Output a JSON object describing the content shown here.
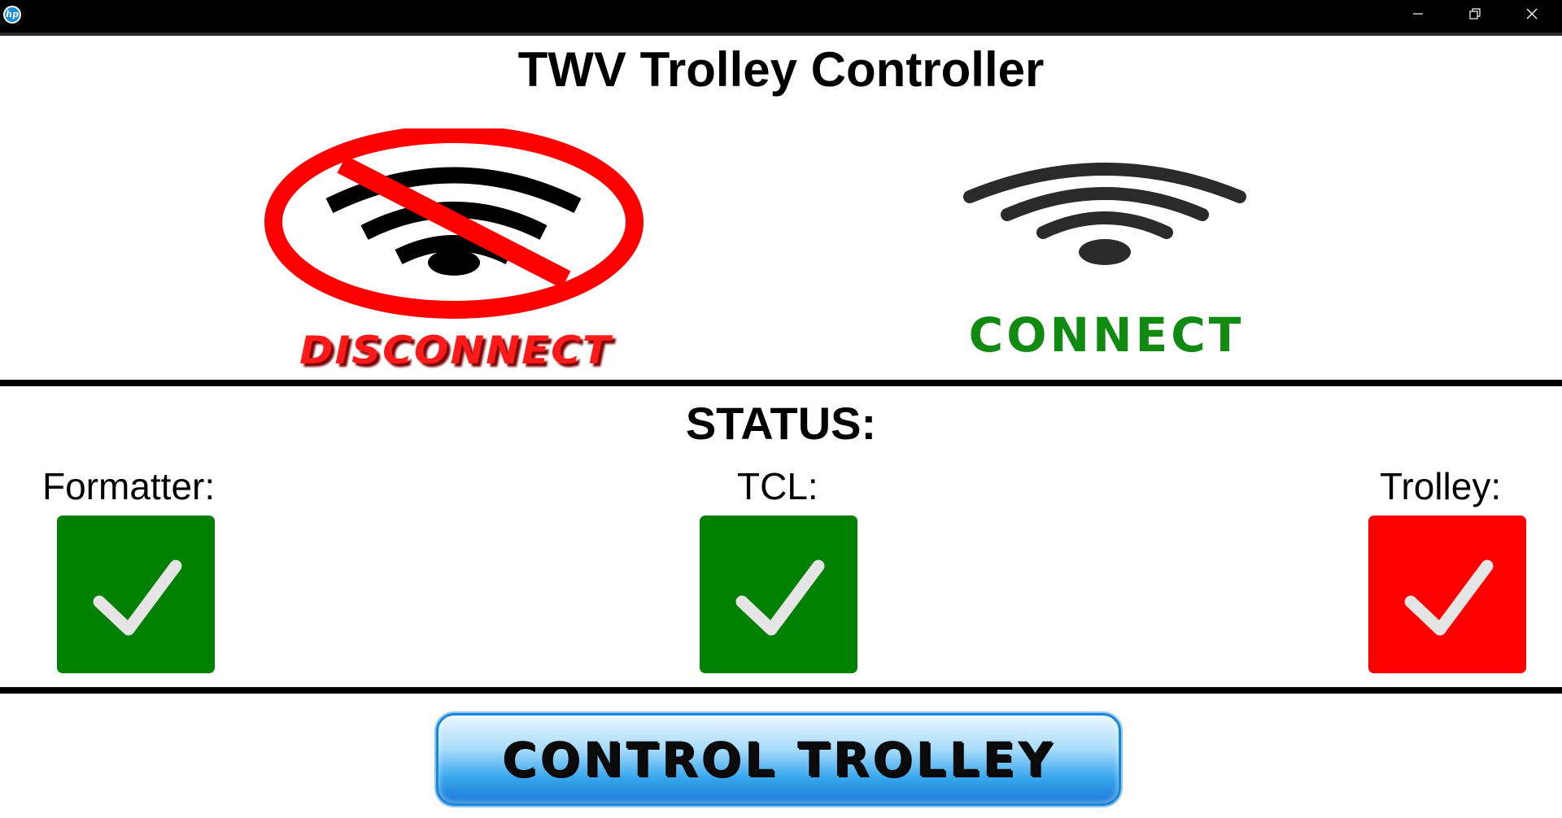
{
  "window": {
    "app_icon_text": "hp",
    "controls": [
      "minimize-icon",
      "restore-icon",
      "close-icon"
    ]
  },
  "header": {
    "title": "TWV Trolley Controller"
  },
  "actions": {
    "disconnect_label": "DISCONNECT",
    "connect_label": "CONNECT",
    "disconnect_icon": "wifi-off-icon",
    "connect_icon": "wifi-icon"
  },
  "status": {
    "title": "STATUS:",
    "items": [
      {
        "label": "Formatter:",
        "state": "ok",
        "color": "#028002",
        "icon": "checkmark-icon"
      },
      {
        "label": "TCL:",
        "state": "ok",
        "color": "#028002",
        "icon": "checkmark-icon"
      },
      {
        "label": "Trolley:",
        "state": "error",
        "color": "#ff0000",
        "icon": "checkmark-icon"
      }
    ]
  },
  "footer": {
    "control_label": "CONTROL TROLLEY"
  },
  "colors": {
    "disconnect": "#ff1a1a",
    "connect": "#118a11",
    "ok": "#028002",
    "error": "#ff0000",
    "button_blue": "#1b79d9"
  }
}
